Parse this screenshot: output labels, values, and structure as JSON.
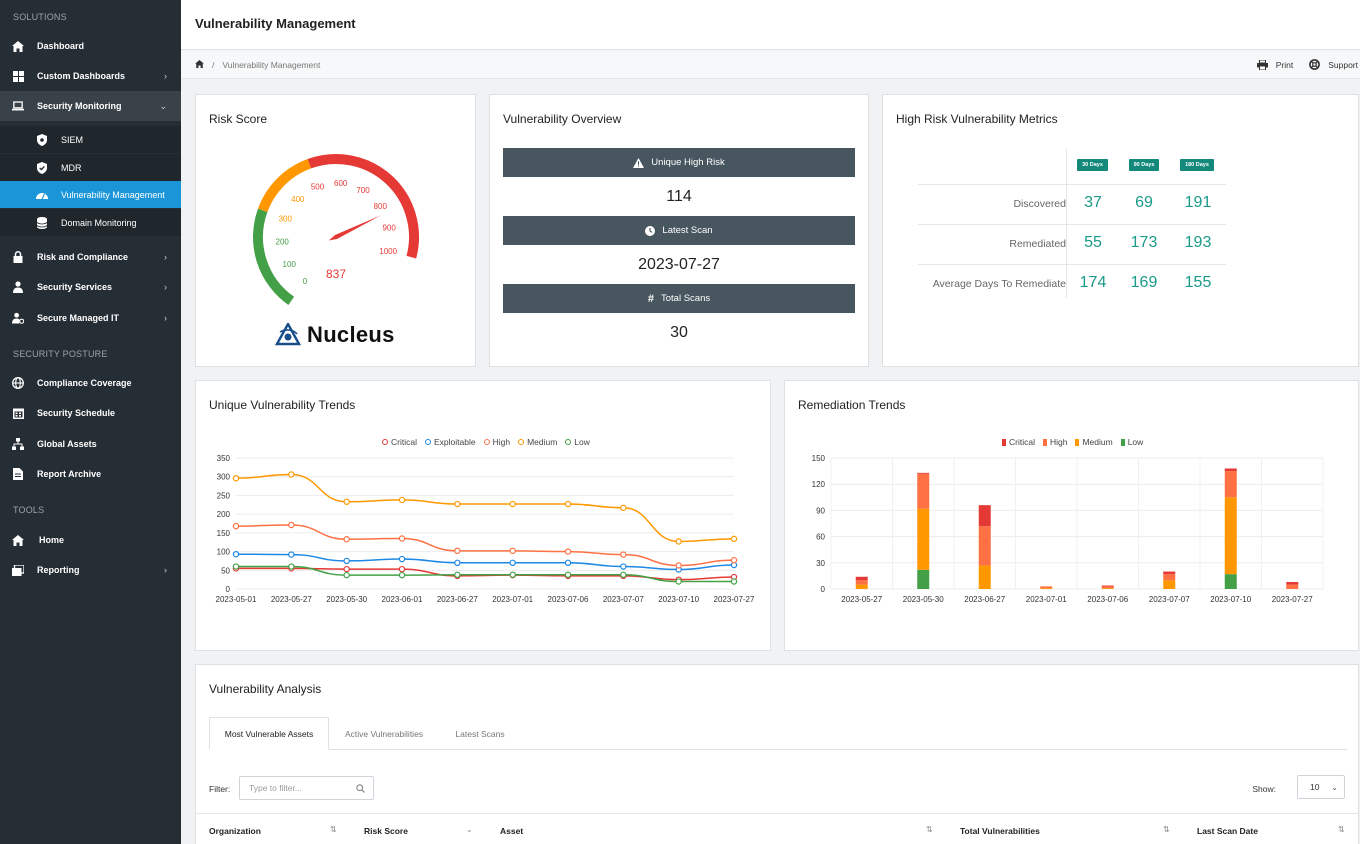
{
  "sidebar": {
    "sections": {
      "solutions": "SOLUTIONS",
      "posture": "SECURITY POSTURE",
      "tools": "TOOLS"
    },
    "items": {
      "dashboard": "Dashboard",
      "custom_dashboards": "Custom Dashboards",
      "security_monitoring": "Security Monitoring",
      "siem": "SIEM",
      "mdr": "MDR",
      "vulnerability_management": "Vulnerability Management",
      "domain_monitoring": "Domain Monitoring",
      "risk_compliance": "Risk and Compliance",
      "security_services": "Security Services",
      "secure_managed_it": "Secure Managed IT",
      "compliance_coverage": "Compliance Coverage",
      "security_schedule": "Security Schedule",
      "global_assets": "Global Assets",
      "report_archive": "Report Archive",
      "home": "Home",
      "reporting": "Reporting"
    }
  },
  "header": {
    "title": "Vulnerability Management"
  },
  "breadcrumb": {
    "current": "Vulnerability Management"
  },
  "actions": {
    "print": "Print",
    "support": "Support"
  },
  "risk_score": {
    "title": "Risk Score",
    "value": "837",
    "gauge_max": 1000,
    "ticks": [
      "0",
      "100",
      "200",
      "300",
      "400",
      "500",
      "600",
      "700",
      "800",
      "900",
      "1000"
    ],
    "logo": "Nucleus"
  },
  "overview": {
    "title": "Vulnerability Overview",
    "unique_high_label": "Unique High Risk",
    "unique_high_value": "114",
    "latest_scan_label": "Latest Scan",
    "latest_scan_value": "2023-07-27",
    "total_scans_label": "Total Scans",
    "total_scans_value": "30"
  },
  "high_risk": {
    "title": "High Risk Vulnerability Metrics",
    "columns": [
      "30 Days",
      "90 Days",
      "180 Days"
    ],
    "rows": [
      {
        "label": "Discovered",
        "values": [
          "37",
          "69",
          "191"
        ]
      },
      {
        "label": "Remediated",
        "values": [
          "55",
          "173",
          "193"
        ]
      },
      {
        "label": "Average Days To Remediate",
        "values": [
          "174",
          "169",
          "155"
        ]
      }
    ]
  },
  "colors": {
    "critical": "#e53935",
    "exploitable": "#1e88e5",
    "high": "#ff7043",
    "medium": "#ff9800",
    "low": "#43a047",
    "accent": "#1b95d8"
  },
  "trends_title": "Unique Vulnerability Trends",
  "remediation_title": "Remediation Trends",
  "chart_data": [
    {
      "type": "line",
      "x": [
        "2023-05-01",
        "2023-05-27",
        "2023-05-30",
        "2023-06-01",
        "2023-06-27",
        "2023-07-01",
        "2023-07-06",
        "2023-07-07",
        "2023-07-10",
        "2023-07-27"
      ],
      "ylim": [
        0,
        350
      ],
      "yticks": [
        0,
        50,
        100,
        150,
        200,
        250,
        300,
        350
      ],
      "series": [
        {
          "name": "Critical",
          "color": "#e53935",
          "values": [
            55,
            55,
            53,
            53,
            35,
            37,
            35,
            35,
            25,
            32
          ]
        },
        {
          "name": "Exploitable",
          "color": "#1e88e5",
          "values": [
            93,
            92,
            75,
            80,
            70,
            70,
            70,
            60,
            52,
            64
          ]
        },
        {
          "name": "High",
          "color": "#ff7043",
          "values": [
            168,
            171,
            133,
            135,
            102,
            102,
            100,
            92,
            63,
            77
          ]
        },
        {
          "name": "Medium",
          "color": "#ff9800",
          "values": [
            296,
            306,
            233,
            238,
            227,
            227,
            227,
            217,
            127,
            134
          ]
        },
        {
          "name": "Low",
          "color": "#43a047",
          "values": [
            60,
            60,
            37,
            37,
            38,
            38,
            38,
            38,
            20,
            20
          ]
        }
      ]
    },
    {
      "type": "bar",
      "stacked": true,
      "categories": [
        "2023-05-27",
        "2023-05-30",
        "2023-06-27",
        "2023-07-01",
        "2023-07-06",
        "2023-07-07",
        "2023-07-10",
        "2023-07-27"
      ],
      "ylim": [
        0,
        150
      ],
      "yticks": [
        0,
        30,
        60,
        90,
        120,
        150
      ],
      "series": [
        {
          "name": "Low",
          "color": "#43a047",
          "values": [
            0,
            22,
            0,
            0,
            0,
            0,
            17,
            0
          ]
        },
        {
          "name": "Medium",
          "color": "#ff9800",
          "values": [
            5,
            70,
            27,
            1,
            1,
            10,
            88,
            0
          ]
        },
        {
          "name": "High",
          "color": "#ff7043",
          "values": [
            5,
            40,
            45,
            2,
            2,
            7,
            30,
            5
          ]
        },
        {
          "name": "Critical",
          "color": "#e53935",
          "values": [
            4,
            1,
            24,
            0,
            1,
            3,
            3,
            3
          ]
        }
      ]
    }
  ],
  "analysis": {
    "title": "Vulnerability Analysis",
    "tabs": [
      "Most Vulnerable Assets",
      "Active Vulnerabilities",
      "Latest Scans"
    ],
    "filter_label": "Filter:",
    "filter_placeholder": "Type to filter...",
    "show_label": "Show:",
    "show_value": "10",
    "columns": [
      "Organization",
      "Risk Score",
      "Asset",
      "Total Vulnerabilities",
      "Last Scan Date"
    ]
  }
}
